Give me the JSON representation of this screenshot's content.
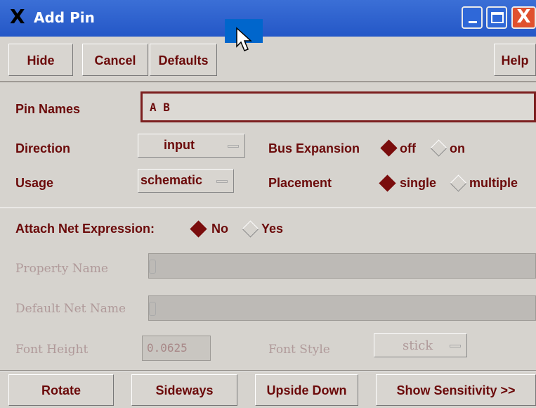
{
  "window": {
    "title": "Add Pin",
    "logo_text": "X",
    "close_label": "X"
  },
  "toolbar": {
    "hide": "Hide",
    "cancel": "Cancel",
    "defaults": "Defaults",
    "help": "Help"
  },
  "form": {
    "pin_names_label": "Pin Names",
    "pin_names_value": "A B",
    "direction_label": "Direction",
    "direction_value": "input",
    "bus_expansion_label": "Bus Expansion",
    "bus_off": "off",
    "bus_on": "on",
    "usage_label": "Usage",
    "usage_value": "schematic",
    "placement_label": "Placement",
    "placement_single": "single",
    "placement_multiple": "multiple",
    "attach_label": "Attach Net Expression:",
    "attach_no": "No",
    "attach_yes": "Yes",
    "property_name_label": "Property Name",
    "default_net_name_label": "Default Net Name",
    "font_height_label": "Font Height",
    "font_height_value": "0.0625",
    "font_style_label": "Font Style",
    "font_style_value": "stick"
  },
  "actions": {
    "rotate": "Rotate",
    "sideways": "Sideways",
    "upside_down": "Upside Down",
    "show_sensitivity": "Show Sensitivity >>"
  },
  "colors": {
    "accent": "#6b0a0a",
    "titlebar": "#2457c7"
  },
  "icons": [
    "x-logo-icon",
    "minimize-icon",
    "maximize-icon",
    "close-icon",
    "radio-diamond-icon",
    "dropdown-indicator-icon",
    "mouse-pointer-icon"
  ]
}
